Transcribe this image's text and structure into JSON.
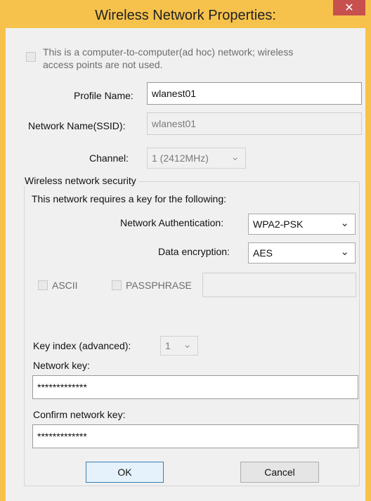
{
  "window": {
    "title": "Wireless Network Properties:",
    "close_glyph": "✕"
  },
  "adhoc": {
    "label_line1": "This is a computer-to-computer(ad hoc) network; wireless",
    "label_line2": "access points are not used."
  },
  "profile": {
    "label": "Profile Name:",
    "value": "wlanest01"
  },
  "ssid": {
    "label": "Network Name(SSID):",
    "value": "wlanest01"
  },
  "channel": {
    "label": "Channel:",
    "value": "1  (2412MHz)"
  },
  "security": {
    "group_label": "Wireless network security",
    "intro": "This network requires a key for the following:",
    "auth_label": "Network Authentication:",
    "auth_value": "WPA2-PSK",
    "enc_label": "Data encryption:",
    "enc_value": "AES",
    "ascii_label": "ASCII",
    "passphrase_label": "PASSPHRASE",
    "passphrase_value": "",
    "key_index_label": "Key index (advanced):",
    "key_index_value": "1",
    "network_key_label": "Network key:",
    "network_key_value": "*************",
    "confirm_key_label": "Confirm network key:",
    "confirm_key_value": "*************"
  },
  "buttons": {
    "ok": "OK",
    "cancel": "Cancel"
  },
  "icons": {
    "dropdown": "chevron-down-icon",
    "close": "close-icon"
  },
  "colors": {
    "titlebar": "#f6c24c",
    "close": "#c7504e",
    "client": "#f0f0f0"
  }
}
